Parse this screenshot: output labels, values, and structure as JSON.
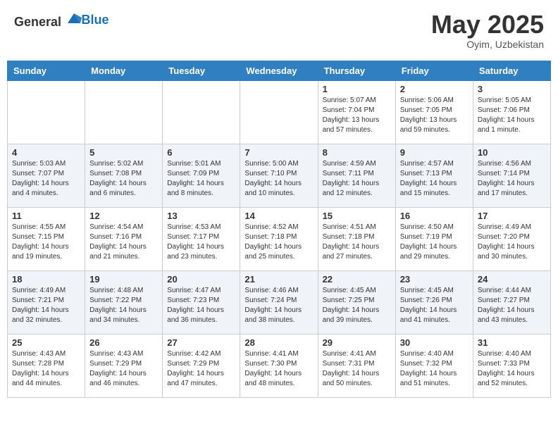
{
  "header": {
    "logo_general": "General",
    "logo_blue": "Blue",
    "month_title": "May 2025",
    "location": "Oyim, Uzbekistan"
  },
  "days_of_week": [
    "Sunday",
    "Monday",
    "Tuesday",
    "Wednesday",
    "Thursday",
    "Friday",
    "Saturday"
  ],
  "weeks": [
    [
      {
        "day": "",
        "info": ""
      },
      {
        "day": "",
        "info": ""
      },
      {
        "day": "",
        "info": ""
      },
      {
        "day": "",
        "info": ""
      },
      {
        "day": "1",
        "info": "Sunrise: 5:07 AM\nSunset: 7:04 PM\nDaylight: 13 hours\nand 57 minutes."
      },
      {
        "day": "2",
        "info": "Sunrise: 5:06 AM\nSunset: 7:05 PM\nDaylight: 13 hours\nand 59 minutes."
      },
      {
        "day": "3",
        "info": "Sunrise: 5:05 AM\nSunset: 7:06 PM\nDaylight: 14 hours\nand 1 minute."
      }
    ],
    [
      {
        "day": "4",
        "info": "Sunrise: 5:03 AM\nSunset: 7:07 PM\nDaylight: 14 hours\nand 4 minutes."
      },
      {
        "day": "5",
        "info": "Sunrise: 5:02 AM\nSunset: 7:08 PM\nDaylight: 14 hours\nand 6 minutes."
      },
      {
        "day": "6",
        "info": "Sunrise: 5:01 AM\nSunset: 7:09 PM\nDaylight: 14 hours\nand 8 minutes."
      },
      {
        "day": "7",
        "info": "Sunrise: 5:00 AM\nSunset: 7:10 PM\nDaylight: 14 hours\nand 10 minutes."
      },
      {
        "day": "8",
        "info": "Sunrise: 4:59 AM\nSunset: 7:11 PM\nDaylight: 14 hours\nand 12 minutes."
      },
      {
        "day": "9",
        "info": "Sunrise: 4:57 AM\nSunset: 7:13 PM\nDaylight: 14 hours\nand 15 minutes."
      },
      {
        "day": "10",
        "info": "Sunrise: 4:56 AM\nSunset: 7:14 PM\nDaylight: 14 hours\nand 17 minutes."
      }
    ],
    [
      {
        "day": "11",
        "info": "Sunrise: 4:55 AM\nSunset: 7:15 PM\nDaylight: 14 hours\nand 19 minutes."
      },
      {
        "day": "12",
        "info": "Sunrise: 4:54 AM\nSunset: 7:16 PM\nDaylight: 14 hours\nand 21 minutes."
      },
      {
        "day": "13",
        "info": "Sunrise: 4:53 AM\nSunset: 7:17 PM\nDaylight: 14 hours\nand 23 minutes."
      },
      {
        "day": "14",
        "info": "Sunrise: 4:52 AM\nSunset: 7:18 PM\nDaylight: 14 hours\nand 25 minutes."
      },
      {
        "day": "15",
        "info": "Sunrise: 4:51 AM\nSunset: 7:18 PM\nDaylight: 14 hours\nand 27 minutes."
      },
      {
        "day": "16",
        "info": "Sunrise: 4:50 AM\nSunset: 7:19 PM\nDaylight: 14 hours\nand 29 minutes."
      },
      {
        "day": "17",
        "info": "Sunrise: 4:49 AM\nSunset: 7:20 PM\nDaylight: 14 hours\nand 30 minutes."
      }
    ],
    [
      {
        "day": "18",
        "info": "Sunrise: 4:49 AM\nSunset: 7:21 PM\nDaylight: 14 hours\nand 32 minutes."
      },
      {
        "day": "19",
        "info": "Sunrise: 4:48 AM\nSunset: 7:22 PM\nDaylight: 14 hours\nand 34 minutes."
      },
      {
        "day": "20",
        "info": "Sunrise: 4:47 AM\nSunset: 7:23 PM\nDaylight: 14 hours\nand 36 minutes."
      },
      {
        "day": "21",
        "info": "Sunrise: 4:46 AM\nSunset: 7:24 PM\nDaylight: 14 hours\nand 38 minutes."
      },
      {
        "day": "22",
        "info": "Sunrise: 4:45 AM\nSunset: 7:25 PM\nDaylight: 14 hours\nand 39 minutes."
      },
      {
        "day": "23",
        "info": "Sunrise: 4:45 AM\nSunset: 7:26 PM\nDaylight: 14 hours\nand 41 minutes."
      },
      {
        "day": "24",
        "info": "Sunrise: 4:44 AM\nSunset: 7:27 PM\nDaylight: 14 hours\nand 43 minutes."
      }
    ],
    [
      {
        "day": "25",
        "info": "Sunrise: 4:43 AM\nSunset: 7:28 PM\nDaylight: 14 hours\nand 44 minutes."
      },
      {
        "day": "26",
        "info": "Sunrise: 4:43 AM\nSunset: 7:29 PM\nDaylight: 14 hours\nand 46 minutes."
      },
      {
        "day": "27",
        "info": "Sunrise: 4:42 AM\nSunset: 7:29 PM\nDaylight: 14 hours\nand 47 minutes."
      },
      {
        "day": "28",
        "info": "Sunrise: 4:41 AM\nSunset: 7:30 PM\nDaylight: 14 hours\nand 48 minutes."
      },
      {
        "day": "29",
        "info": "Sunrise: 4:41 AM\nSunset: 7:31 PM\nDaylight: 14 hours\nand 50 minutes."
      },
      {
        "day": "30",
        "info": "Sunrise: 4:40 AM\nSunset: 7:32 PM\nDaylight: 14 hours\nand 51 minutes."
      },
      {
        "day": "31",
        "info": "Sunrise: 4:40 AM\nSunset: 7:33 PM\nDaylight: 14 hours\nand 52 minutes."
      }
    ]
  ]
}
